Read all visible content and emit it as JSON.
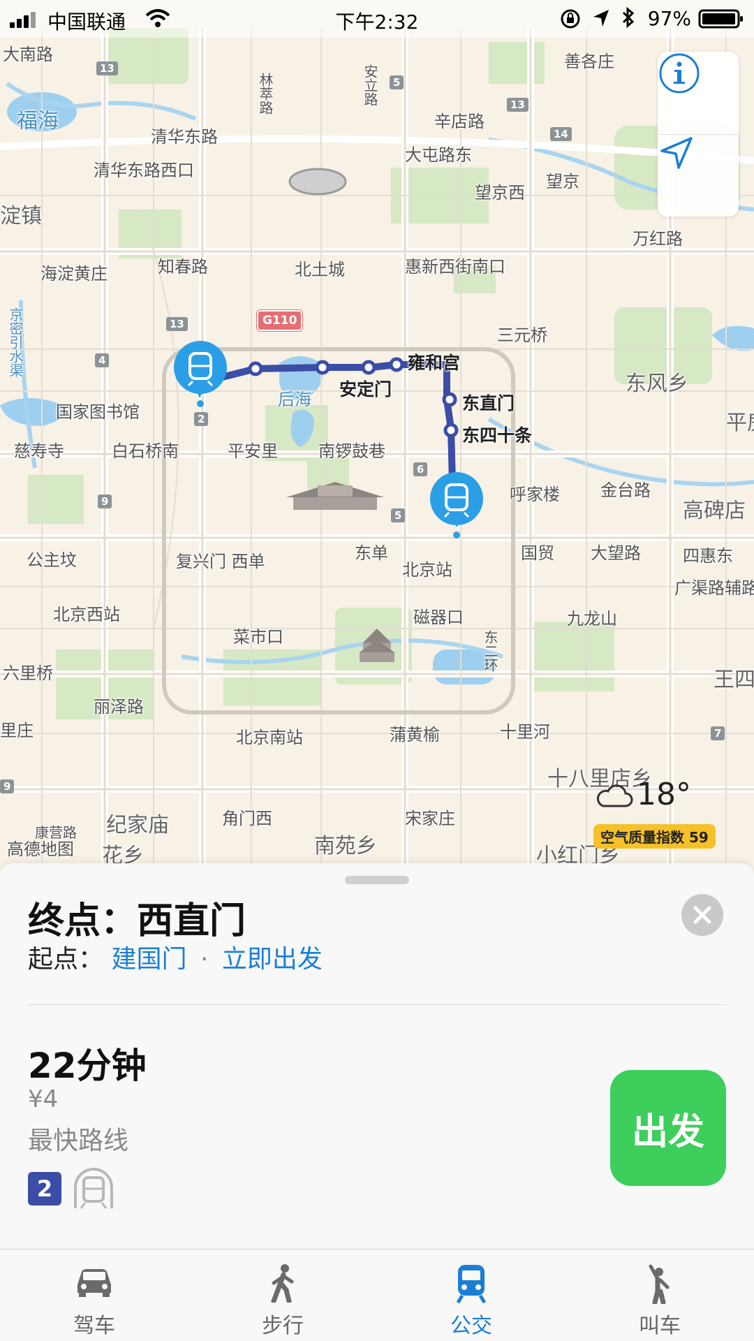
{
  "status_bar": {
    "carrier": "中国联通",
    "time": "下午2:32",
    "battery": "97%"
  },
  "map": {
    "places": [
      {
        "name": "大南路"
      },
      {
        "name": "福海"
      },
      {
        "name": "清华东路"
      },
      {
        "name": "清华东路西口"
      },
      {
        "name": "淀镇"
      },
      {
        "name": "海淀黄庄"
      },
      {
        "name": "知春路"
      },
      {
        "name": "北土城"
      },
      {
        "name": "惠新西街南口"
      },
      {
        "name": "大屯路东"
      },
      {
        "name": "望京西"
      },
      {
        "name": "望京"
      },
      {
        "name": "辛店路"
      },
      {
        "name": "善各庄"
      },
      {
        "name": "万红路"
      },
      {
        "name": "三元桥"
      },
      {
        "name": "东风乡"
      },
      {
        "name": "平房"
      },
      {
        "name": "国家图书馆"
      },
      {
        "name": "慈寿寺"
      },
      {
        "name": "白石桥南"
      },
      {
        "name": "平安里"
      },
      {
        "name": "南锣鼓巷"
      },
      {
        "name": "后海"
      },
      {
        "name": "呼家楼"
      },
      {
        "name": "金台路"
      },
      {
        "name": "高碑店"
      },
      {
        "name": "公主坟"
      },
      {
        "name": "复兴门 西单"
      },
      {
        "name": "东单"
      },
      {
        "name": "北京站"
      },
      {
        "name": "国贸"
      },
      {
        "name": "大望路"
      },
      {
        "name": "四惠东"
      },
      {
        "name": "广渠路辅路"
      },
      {
        "name": "北京西站"
      },
      {
        "name": "磁器口"
      },
      {
        "name": "九龙山"
      },
      {
        "name": "菜市口"
      },
      {
        "name": "六里桥"
      },
      {
        "name": "丽泽路"
      },
      {
        "name": "王四营"
      },
      {
        "name": "北京南站"
      },
      {
        "name": "蒲黄榆"
      },
      {
        "name": "十里河"
      },
      {
        "name": "里庄"
      },
      {
        "name": "十八里店乡"
      },
      {
        "name": "纪家庙"
      },
      {
        "name": "角门西"
      },
      {
        "name": "宋家庄"
      },
      {
        "name": "康营路"
      },
      {
        "name": "花乡"
      },
      {
        "name": "南苑乡"
      },
      {
        "name": "小红门乡"
      },
      {
        "name": "京密引水渠"
      },
      {
        "name": "林萃路"
      },
      {
        "name": "安立路"
      },
      {
        "name": "东二环"
      }
    ],
    "stations": [
      "雍和宫",
      "安定门",
      "东直门",
      "东四十条"
    ],
    "road_shields": [
      "13",
      "5",
      "13",
      "14",
      "13",
      "4",
      "2",
      "6",
      "9",
      "5",
      "7",
      "9"
    ],
    "highway_shield": "G110",
    "controls": {
      "info": "info-icon",
      "locate": "location-arrow-icon"
    },
    "weather": {
      "temp": "18°",
      "aqi": "空气质量指数 59"
    },
    "attribution": "高德地图"
  },
  "sheet": {
    "destination": "终点：西直门",
    "origin_label": "起点：",
    "origin_name": "建国门",
    "separator": "·",
    "depart_time": "立即出发",
    "duration": "22分钟",
    "fare": "¥4",
    "route_note": "最快路线",
    "line_number": "2",
    "go_label": "出发"
  },
  "tabs": [
    {
      "label": "驾车",
      "icon": "car-icon",
      "active": false
    },
    {
      "label": "步行",
      "icon": "walk-icon",
      "active": false
    },
    {
      "label": "公交",
      "icon": "transit-icon",
      "active": true
    },
    {
      "label": "叫车",
      "icon": "hail-icon",
      "active": false
    }
  ],
  "colors": {
    "route": "#3b4da7",
    "pin": "#2b9fe6",
    "link": "#1a7fd4",
    "go": "#3dce5c",
    "aqi": "#f6c028"
  }
}
